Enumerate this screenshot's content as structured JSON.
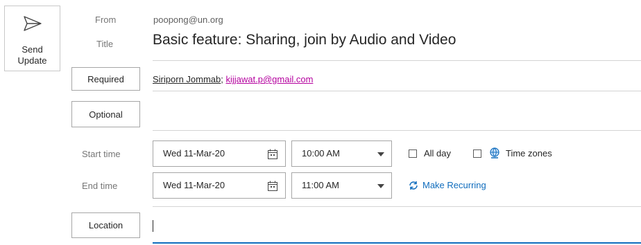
{
  "toolbar": {
    "send_update_label": "Send\nUpdate"
  },
  "header": {
    "from_label": "From",
    "from_value": "poopong@un.org",
    "title_label": "Title",
    "title_value": "Basic feature: Sharing, join by Audio and Video"
  },
  "recipients": {
    "required_label": "Required",
    "required_names": [
      "Siriporn Jommab",
      "kijjawat.p@gmail.com"
    ],
    "separator": ";",
    "optional_label": "Optional"
  },
  "schedule": {
    "start_label": "Start time",
    "start_date": "Wed 11-Mar-20",
    "start_time": "10:00 AM",
    "end_label": "End time",
    "end_date": "Wed 11-Mar-20",
    "end_time": "11:00 AM",
    "all_day_label": "All day",
    "all_day_checked": false,
    "time_zones_label": "Time zones",
    "time_zones_checked": false,
    "make_recurring_label": "Make Recurring"
  },
  "location": {
    "label": "Location",
    "value": ""
  },
  "colors": {
    "accent": "#0f6cbd",
    "link_magenta": "#b4009e",
    "border": "#a6a6a6",
    "divider": "#d4d4d4",
    "muted_text": "#767676"
  }
}
